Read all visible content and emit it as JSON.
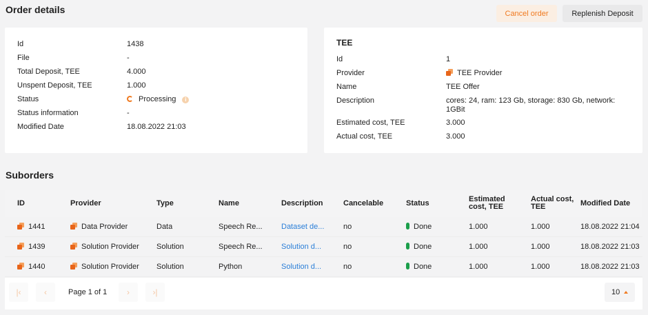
{
  "page": {
    "title": "Order details",
    "suborders_title": "Suborders"
  },
  "actions": {
    "cancel_label": "Cancel order",
    "replenish_label": "Replenish Deposit"
  },
  "order": {
    "fields": [
      {
        "key": "Id",
        "value": "1438"
      },
      {
        "key": "File",
        "value": "-"
      },
      {
        "key": "Total Deposit, TEE",
        "value": "4.000"
      },
      {
        "key": "Unspent Deposit, TEE",
        "value": "1.000"
      },
      {
        "key": "Status",
        "value": "Processing"
      },
      {
        "key": "Status information",
        "value": "-"
      },
      {
        "key": "Modified Date",
        "value": "18.08.2022 21:03"
      }
    ],
    "info_icon_glyph": "i"
  },
  "tee": {
    "title": "TEE",
    "fields": [
      {
        "key": "Id",
        "value": "1"
      },
      {
        "key": "Provider",
        "value": "TEE Provider"
      },
      {
        "key": "Name",
        "value": "TEE Offer"
      },
      {
        "key": "Description",
        "value": "cores: 24, ram: 123 Gb, storage: 830 Gb, network: 1GBit"
      },
      {
        "key": "Estimated cost, TEE",
        "value": "3.000"
      },
      {
        "key": "Actual cost, TEE",
        "value": "3.000"
      }
    ]
  },
  "suborders": {
    "columns": [
      "ID",
      "Provider",
      "Type",
      "Name",
      "Description",
      "Cancelable",
      "Status",
      "Estimated cost, TEE",
      "Actual cost, TEE",
      "Modified Date"
    ],
    "rows": [
      {
        "id": "1441",
        "provider": "Data Provider",
        "type": "Data",
        "name": "Speech Re...",
        "description": "Dataset de...",
        "cancelable": "no",
        "status": "Done",
        "estimated": "1.000",
        "actual": "1.000",
        "modified": "18.08.2022 21:04"
      },
      {
        "id": "1439",
        "provider": "Solution Provider",
        "type": "Solution",
        "name": "Speech Re...",
        "description": "Solution d...",
        "cancelable": "no",
        "status": "Done",
        "estimated": "1.000",
        "actual": "1.000",
        "modified": "18.08.2022 21:03"
      },
      {
        "id": "1440",
        "provider": "Solution Provider",
        "type": "Solution",
        "name": "Python",
        "description": "Solution d...",
        "cancelable": "no",
        "status": "Done",
        "estimated": "1.000",
        "actual": "1.000",
        "modified": "18.08.2022 21:03"
      }
    ]
  },
  "pagination": {
    "label": "Page 1 of 1",
    "page_size": "10",
    "first_glyph": "|‹",
    "prev_glyph": "‹",
    "next_glyph": "›",
    "last_glyph": "›|"
  },
  "colors": {
    "accent": "#f07a20",
    "link": "#2b7fd8",
    "done": "#1a9e4a"
  }
}
